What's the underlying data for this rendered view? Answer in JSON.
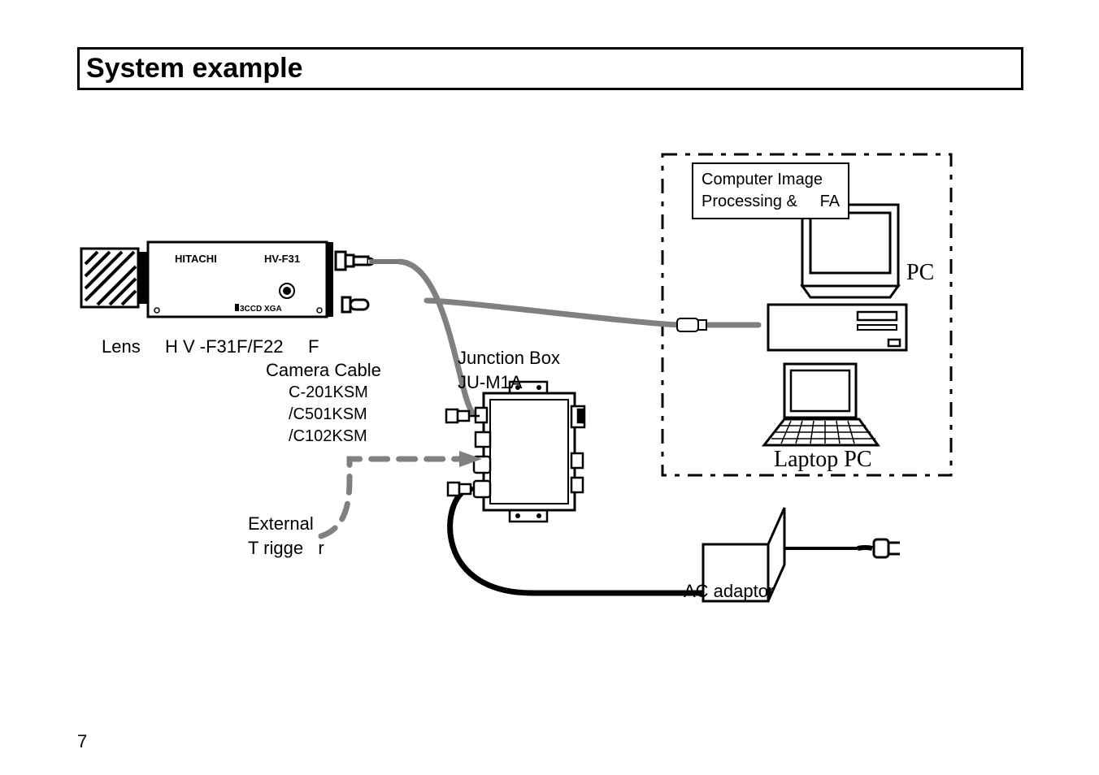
{
  "title": "System example",
  "labels": {
    "lens": "Lens",
    "camera_model": "H V -F31F/F22     F",
    "camera_cable_title": "Camera Cable",
    "camera_cable_models": "C-201KSM\n/C501KSM\n/C102KSM",
    "external_trigger": "External\nT rigge   r",
    "junction_box": "Junction Box\nJU-M1A",
    "ac_adaptor": "AC adaptor",
    "pc": "PC",
    "laptop": "Laptop PC",
    "computer_box": "Computer Image\nProcessing &     FA"
  },
  "camera_body": {
    "brand": "HITACHI",
    "model": "HV-F31",
    "marks": "3CCD  XGA"
  },
  "page_number": "7"
}
